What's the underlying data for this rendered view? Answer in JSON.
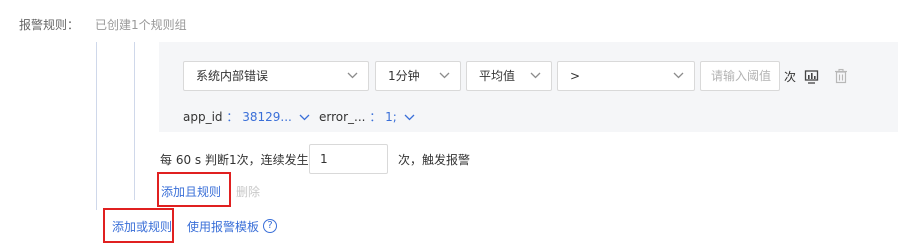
{
  "rules": {
    "label": "报警规则：",
    "summary": "已创建1个规则组"
  },
  "condition": {
    "metric": "系统内部错误",
    "period": "1分钟",
    "aggregation": "平均值",
    "operator": ">",
    "threshold_placeholder": "请输入阈值",
    "unit": "次"
  },
  "tags": {
    "key1": "app_id",
    "sep1": "：",
    "val1": "38129...",
    "key2": "error_...",
    "sep2": "：",
    "val2": "1;"
  },
  "trigger": {
    "prefix": "每 60 s 判断1次，连续发生",
    "count": "1",
    "suffix": "次，触发报警"
  },
  "actions": {
    "add_and_rule": "添加且规则",
    "delete": "删除",
    "add_or_rule": "添加或规则",
    "use_template": "使用报警模板",
    "help_glyph": "?"
  },
  "icons": {
    "chart": "chart-icon",
    "trash": "trash-icon",
    "help": "help-icon"
  },
  "colors": {
    "link": "#3a6fd8",
    "highlight": "#e02020",
    "panel_bg": "#f5f6f8"
  }
}
